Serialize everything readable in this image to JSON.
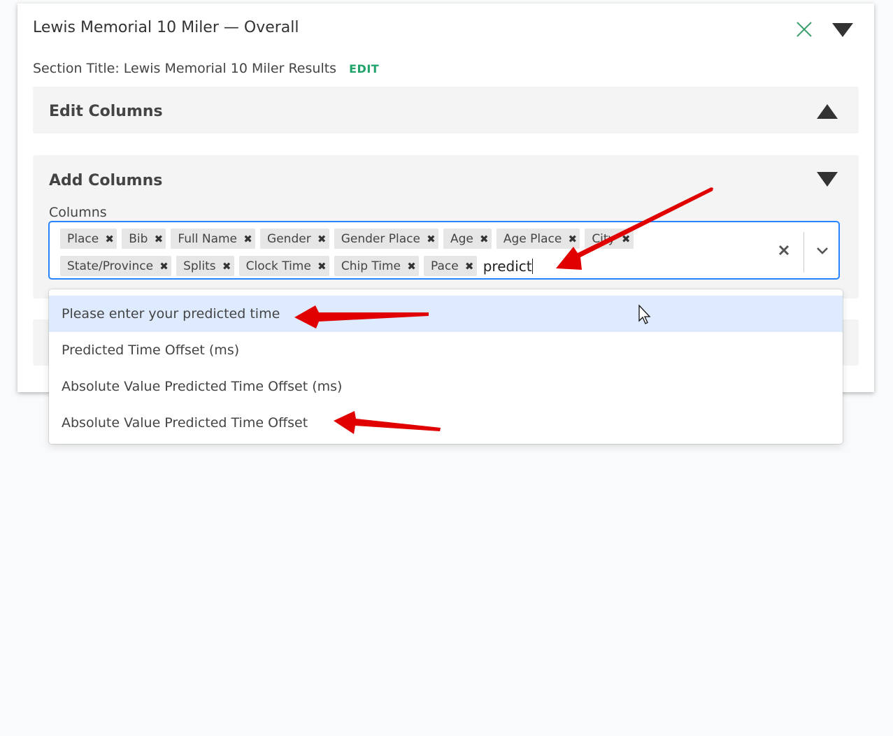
{
  "card": {
    "title": "Lewis Memorial 10 Miler — Overall",
    "section_title_label": "Section Title: Lewis Memorial 10 Miler Results",
    "edit_label": "EDIT"
  },
  "edit_columns": {
    "title": "Edit Columns"
  },
  "add_columns": {
    "title": "Add Columns",
    "columns_label": "Columns",
    "chips_row1": [
      {
        "label": "Place"
      },
      {
        "label": "Bib"
      },
      {
        "label": "Full Name"
      },
      {
        "label": "Gender"
      },
      {
        "label": "Gender Place"
      },
      {
        "label": "Age"
      },
      {
        "label": "Age Place"
      },
      {
        "label": "City"
      }
    ],
    "chips_row2": [
      {
        "label": "State/Province"
      },
      {
        "label": "Splits"
      },
      {
        "label": "Clock Time"
      },
      {
        "label": "Chip Time"
      },
      {
        "label": "Pace"
      }
    ],
    "input_value": "predict"
  },
  "dropdown": {
    "options": [
      {
        "label": "Please enter your predicted time"
      },
      {
        "label": "Predicted Time Offset (ms)"
      },
      {
        "label": "Absolute Value Predicted Time Offset (ms)"
      },
      {
        "label": "Absolute Value Predicted Time Offset"
      }
    ]
  },
  "colors": {
    "accent_green": "#1fa36b",
    "focus_blue": "#2684ff",
    "option_highlight": "#deebff",
    "annotation_red": "#e00000"
  },
  "icons": [
    "close-icon",
    "collapse-triangle-icon",
    "chip-remove-icon",
    "clear-icon",
    "chevron-down-icon",
    "mouse-cursor-icon"
  ]
}
